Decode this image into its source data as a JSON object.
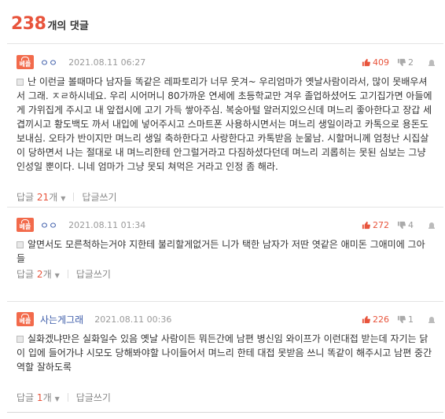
{
  "header": {
    "count": "238",
    "suffix": "개의 댓글"
  },
  "best_label": "베플",
  "reply_label": "답글",
  "reply_unit": "개",
  "write_reply_label": "답글쓰기",
  "comments": [
    {
      "nick": "ㅇㅇ",
      "date": "2021.08.11 06:27",
      "likes": "409",
      "dislikes": "2",
      "text": "난 이런글 볼때마다 남자들 똑같은 레파토리가 너무 웃겨~ 우리엄마가 옛날사람이라서, 많이 못배우셔서 그래. ㅈㄹ하시네요. 우리 시어머니 80가까운 연세에 초등학교만 겨우 졸업하셨어도 고기집가면 아들에게 가위집게 주시고 내 앞접시에 고기 가득 쌓아주심. 복숭아털 알러지있으신데 며느리 좋아한다고 장갑 세겹끼시고 황도백도 까서 내입에 넣어주시고 스마트폰 사용하시면서는 며느리 생일이라고 카톡으로 용돈도 보내심. 오타가 반이지만 며느리 생일 축하한다고 사랑한다고 카톡받음 눈물남. 시할머니께 엄청난 시집살이 당하면서 나는 절대로 내 며느리한테 안그럴거라고 다짐하셨다던데 며느리 괴롭히는 못된 심보는 그냥 인성일 뿐이다. 니네 엄마가 그냥 못되 쳐먹은 거라고 인정 좀 해라.",
      "reply_count": "21"
    },
    {
      "nick": "ㅇㅇ",
      "date": "2021.08.11 01:34",
      "likes": "272",
      "dislikes": "4",
      "text": "알면서도 모른척하는거야 지한테 불리할게없거든 니가 택한 남자가 저딴 엿같은 애미돈 그애미에 그아들",
      "reply_count": "2"
    },
    {
      "nick": "사는게그래",
      "date": "2021.08.11 00:36",
      "likes": "226",
      "dislikes": "1",
      "text": "실화겠냐만은 실화일수 있음 옛날 사람이든 뭐든간에 남편 병신임 와이프가 이런대접 받는데 자기는 닭이 입에 들어가냐 시모도 당해봐야할 나이들어서 며느리 한테 대접 못받음 쓰니 똑같이 해주시고 남편 중간역할 잘하도록",
      "reply_count": "1"
    }
  ]
}
